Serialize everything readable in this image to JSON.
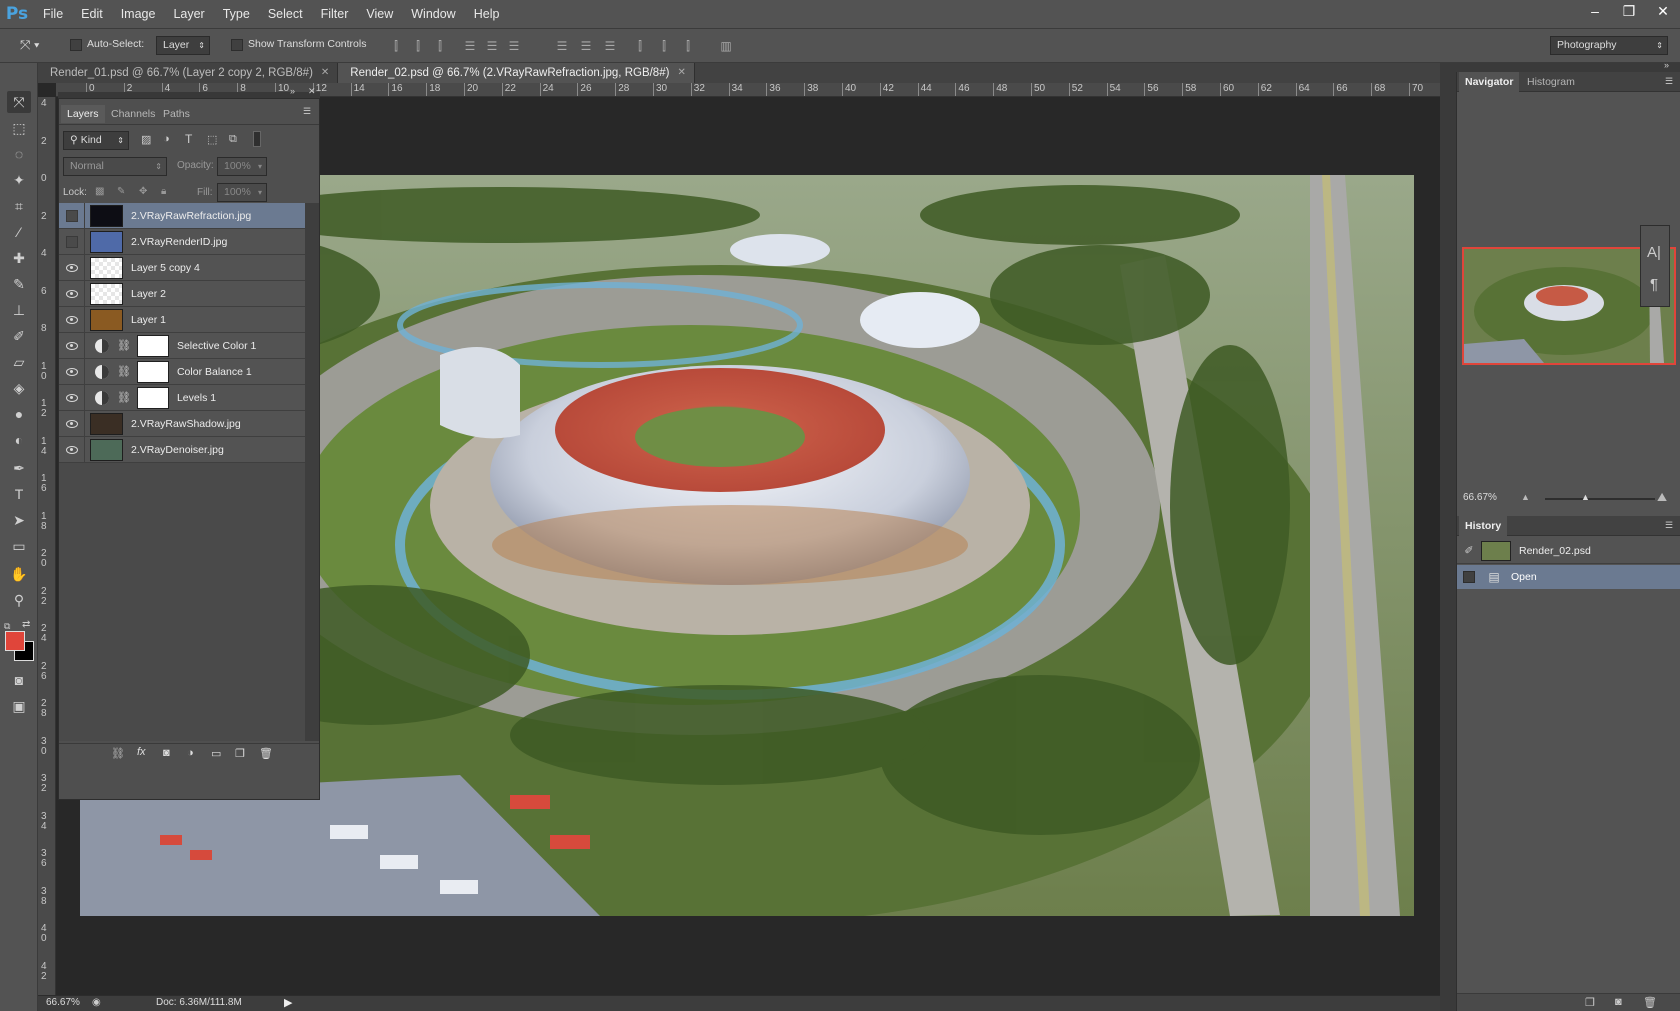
{
  "app": {
    "logo": "Ps",
    "menu": [
      "File",
      "Edit",
      "Image",
      "Layer",
      "Type",
      "Select",
      "Filter",
      "View",
      "Window",
      "Help"
    ],
    "window_controls": [
      "–",
      "❐",
      "✕"
    ]
  },
  "options_bar": {
    "auto_select_label": "Auto-Select:",
    "auto_select_target": "Layer",
    "show_transform_label": "Show Transform Controls",
    "workspace": "Photography"
  },
  "doc_tabs": [
    {
      "label": "Render_01.psd @ 66.7% (Layer 2 copy 2, RGB/8#)",
      "active": false
    },
    {
      "label": "Render_02.psd @ 66.7% (2.VRayRawRefraction.jpg, RGB/8#)",
      "active": true
    }
  ],
  "ruler_top": [
    "0",
    "2",
    "4",
    "6",
    "8",
    "10",
    "12",
    "14",
    "16",
    "18",
    "20",
    "22",
    "24",
    "26",
    "28",
    "30",
    "32",
    "34",
    "36",
    "38",
    "40",
    "42",
    "44",
    "46",
    "48",
    "50",
    "52",
    "54",
    "56",
    "58",
    "60",
    "62",
    "64",
    "66",
    "68",
    "70"
  ],
  "ruler_left": [
    "4",
    "2",
    "0",
    "2",
    "4",
    "6",
    "8",
    "1 0",
    "1 2",
    "1 4",
    "1 6",
    "1 8",
    "2 0",
    "2 2",
    "2 4",
    "2 6",
    "2 8",
    "3 0",
    "3 2",
    "3 4",
    "3 6",
    "3 8",
    "4 0",
    "4 2"
  ],
  "layers_panel": {
    "tabs": [
      "Layers",
      "Channels",
      "Paths"
    ],
    "filter_kind": "Kind",
    "blend_mode": "Normal",
    "opacity_label": "Opacity:",
    "opacity_value": "100%",
    "lock_label": "Lock:",
    "fill_label": "Fill:",
    "fill_value": "100%",
    "layers": [
      {
        "name": "2.VRayRawRefraction.jpg",
        "visible": false,
        "selected": true,
        "type": "image",
        "thumb": "#0d0d14"
      },
      {
        "name": "2.VRayRenderID.jpg",
        "visible": false,
        "selected": false,
        "type": "image",
        "thumb": "#4f6aa8"
      },
      {
        "name": "Layer 5 copy 4",
        "visible": true,
        "selected": false,
        "type": "transparent",
        "thumb": ""
      },
      {
        "name": "Layer 2",
        "visible": true,
        "selected": false,
        "type": "transparent",
        "thumb": ""
      },
      {
        "name": "Layer 1",
        "visible": true,
        "selected": false,
        "type": "image",
        "thumb": "#8a5a22"
      },
      {
        "name": "Selective Color 1",
        "visible": true,
        "selected": false,
        "type": "adjustment",
        "thumb": ""
      },
      {
        "name": "Color Balance 1",
        "visible": true,
        "selected": false,
        "type": "adjustment",
        "thumb": ""
      },
      {
        "name": "Levels 1",
        "visible": true,
        "selected": false,
        "type": "adjustment",
        "thumb": ""
      },
      {
        "name": "2.VRayRawShadow.jpg",
        "visible": true,
        "selected": false,
        "type": "image",
        "thumb": "#3a2e24"
      },
      {
        "name": "2.VRayDenoiser.jpg",
        "visible": true,
        "selected": false,
        "type": "image",
        "thumb": "#4d6a58"
      }
    ]
  },
  "navigator": {
    "tabs": [
      "Navigator",
      "Histogram"
    ],
    "zoom": "66.67%"
  },
  "history": {
    "title": "History",
    "snapshot": "Render_02.psd",
    "steps": [
      "Open"
    ]
  },
  "status": {
    "zoom": "66.67%",
    "doc": "Doc: 6.36M/111.8M"
  },
  "colors": {
    "foreground": "#e0453a",
    "background": "#000000",
    "selected_layer": "#6b7a91",
    "accent": "#4aa3df"
  }
}
